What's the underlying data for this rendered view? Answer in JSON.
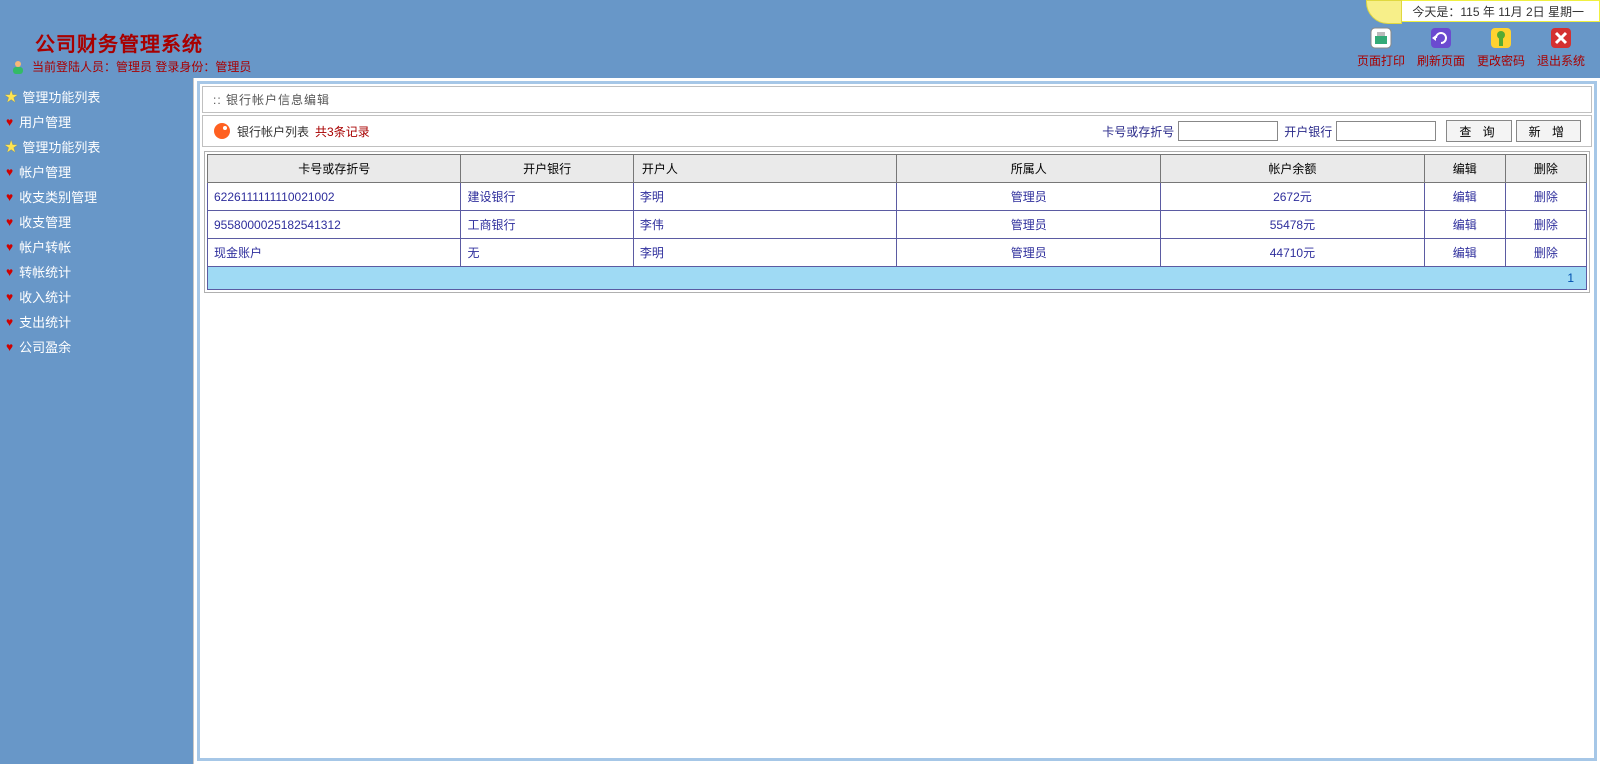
{
  "header": {
    "title": "公司财务管理系统",
    "date_prefix": "今天是：",
    "date_value": "115 年 11月 2日 星期一",
    "login_prefix": "当前登陆人员：",
    "login_user": "管理员",
    "login_role_prefix": " 登录身份：",
    "login_role": "管理员"
  },
  "toolbar": {
    "print": "页面打印",
    "refresh": "刷新页面",
    "password": "更改密码",
    "exit": "退出系统"
  },
  "sidebar": {
    "group1": {
      "header": "管理功能列表",
      "items": [
        "用户管理"
      ]
    },
    "group2": {
      "header": "管理功能列表",
      "items": [
        "帐户管理",
        "收支类别管理",
        "收支管理",
        "帐户转帐",
        "转帐统计",
        "收入统计",
        "支出统计",
        "公司盈余"
      ]
    }
  },
  "panel": {
    "title": ":: 银行帐户信息编辑",
    "list_label": "银行帐户列表",
    "record_count": "共3条记录",
    "filter": {
      "card_label": "卡号或存折号",
      "bank_label": "开户银行",
      "card_value": "",
      "bank_value": "",
      "search_btn": "查 询",
      "add_btn": "新 增"
    }
  },
  "table": {
    "headers": [
      "卡号或存折号",
      "开户银行",
      "开户人",
      "所属人",
      "帐户余额",
      "编辑",
      "删除"
    ],
    "rows": [
      {
        "card": "6226111111110021002",
        "bank": "建设银行",
        "holder": "李明",
        "owner": "管理员",
        "balance": "2672元",
        "edit": "编辑",
        "delete": "删除"
      },
      {
        "card": "9558000025182541312",
        "bank": "工商银行",
        "holder": "李伟",
        "owner": "管理员",
        "balance": "55478元",
        "edit": "编辑",
        "delete": "删除"
      },
      {
        "card": "现金账户",
        "bank": "无",
        "holder": "李明",
        "owner": "管理员",
        "balance": "44710元",
        "edit": "编辑",
        "delete": "删除"
      }
    ],
    "pager": {
      "current": "1"
    }
  }
}
